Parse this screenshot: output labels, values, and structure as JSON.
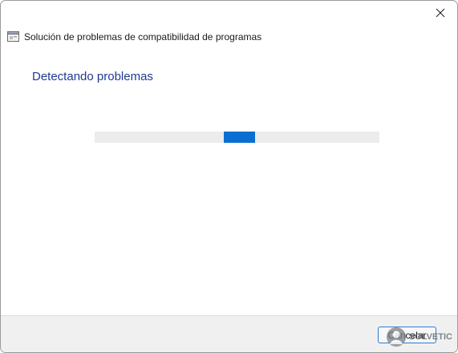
{
  "window": {
    "title": "Solución de problemas de compatibilidad de programas"
  },
  "main": {
    "heading": "Detectando problemas",
    "progress_visible_fraction": 0.11
  },
  "footer": {
    "cancel_label": "Cancelar"
  },
  "watermark": {
    "text": "SOLVETIC"
  },
  "colors": {
    "heading": "#1f3a93",
    "progress": "#0a6fd1",
    "button_border": "#2d7ad6"
  },
  "icons": {
    "close": "close-icon",
    "app": "troubleshooter-icon"
  }
}
